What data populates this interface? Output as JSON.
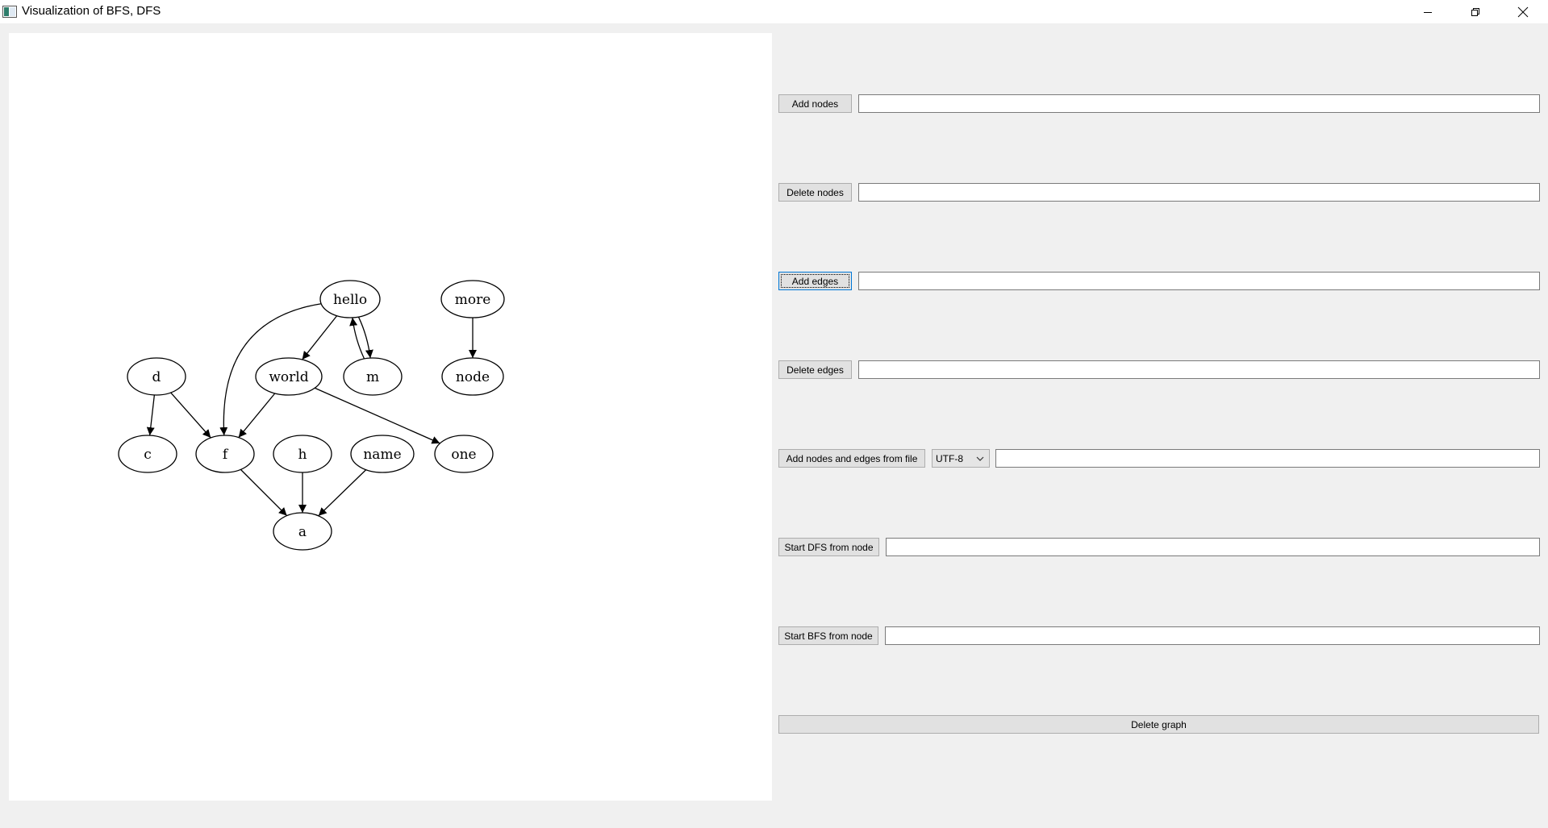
{
  "window": {
    "title": "Visualization of BFS, DFS"
  },
  "graph": {
    "nodes": [
      {
        "id": "hello",
        "label": "hello"
      },
      {
        "id": "more",
        "label": "more"
      },
      {
        "id": "d",
        "label": "d"
      },
      {
        "id": "world",
        "label": "world"
      },
      {
        "id": "m",
        "label": "m"
      },
      {
        "id": "node",
        "label": "node"
      },
      {
        "id": "c",
        "label": "c"
      },
      {
        "id": "f",
        "label": "f"
      },
      {
        "id": "h",
        "label": "h"
      },
      {
        "id": "name",
        "label": "name"
      },
      {
        "id": "one",
        "label": "one"
      },
      {
        "id": "a",
        "label": "a"
      }
    ],
    "edges": [
      {
        "from": "hello",
        "to": "f"
      },
      {
        "from": "hello",
        "to": "world"
      },
      {
        "from": "hello",
        "to": "m"
      },
      {
        "from": "m",
        "to": "hello"
      },
      {
        "from": "more",
        "to": "node"
      },
      {
        "from": "d",
        "to": "c"
      },
      {
        "from": "d",
        "to": "f"
      },
      {
        "from": "world",
        "to": "f"
      },
      {
        "from": "world",
        "to": "one"
      },
      {
        "from": "f",
        "to": "a"
      },
      {
        "from": "h",
        "to": "a"
      },
      {
        "from": "name",
        "to": "a"
      }
    ]
  },
  "controls": {
    "add_nodes": {
      "label": "Add nodes",
      "value": ""
    },
    "delete_nodes": {
      "label": "Delete nodes",
      "value": ""
    },
    "add_edges": {
      "label": "Add edges",
      "value": ""
    },
    "delete_edges": {
      "label": "Delete edges",
      "value": ""
    },
    "add_from_file": {
      "label": "Add nodes and edges from file",
      "encoding": "UTF-8",
      "value": ""
    },
    "start_dfs": {
      "label": "Start DFS from node",
      "value": ""
    },
    "start_bfs": {
      "label": "Start BFS from node",
      "value": ""
    },
    "delete_graph": {
      "label": "Delete graph"
    }
  },
  "icons": {
    "app": "app-icon",
    "minimize": "minimize-icon",
    "restore": "restore-icon",
    "close": "close-icon",
    "dropdown": "chevron-down-icon"
  }
}
